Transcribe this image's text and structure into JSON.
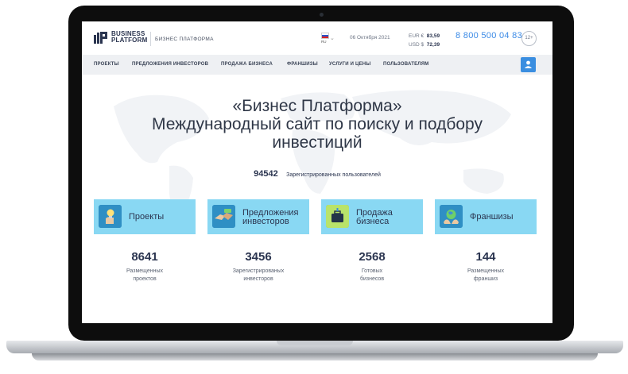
{
  "header": {
    "logo_line1": "BUSINESS",
    "logo_line2": "PLATFORM",
    "slogan": "БИЗНЕС ПЛАТФОРМА",
    "lang_code": "RU",
    "date": "06 Октября 2021",
    "rates": [
      {
        "code": "EUR",
        "symbol": "€",
        "value": "83,59"
      },
      {
        "code": "USD",
        "symbol": "$",
        "value": "72,39"
      }
    ],
    "phone": "8 800 500 04 83",
    "age_badge": "12+"
  },
  "nav": {
    "items": [
      {
        "label": "ПРОЕКТЫ"
      },
      {
        "label": "ПРЕДЛОЖЕНИЯ ИНВЕСТОРОВ"
      },
      {
        "label": "ПРОДАЖА БИЗНЕСА"
      },
      {
        "label": "ФРАНШИЗЫ"
      },
      {
        "label": "УСЛУГИ И ЦЕНЫ"
      },
      {
        "label": "ПОЛЬЗОВАТЕЛЯМ"
      }
    ]
  },
  "hero": {
    "title_line1": "«Бизнес Платформа»",
    "title_line2": "Международный сайт по поиску и подбору",
    "title_line3": "инвестиций",
    "users_count": "94542",
    "users_label": "Зарегистрированных пользователей"
  },
  "cards": [
    {
      "label_line1": "Проекты",
      "label_line2": "",
      "icon": "bulb-icon",
      "count": "8641",
      "stat_line1": "Размещенных",
      "stat_line2": "проектов"
    },
    {
      "label_line1": "Предложения",
      "label_line2": "инвесторов",
      "icon": "handshake-icon",
      "count": "3456",
      "stat_line1": "Зарегистрированых",
      "stat_line2": "инвесторов"
    },
    {
      "label_line1": "Продажа",
      "label_line2": "бизнеса",
      "icon": "briefcase-icon",
      "count": "2568",
      "stat_line1": "Готовых",
      "stat_line2": "бизнесов"
    },
    {
      "label_line1": "Франшизы",
      "label_line2": "",
      "icon": "globe-hands-icon",
      "count": "144",
      "stat_line1": "Размещенных",
      "stat_line2": "франшиз"
    }
  ],
  "colors": {
    "accent": "#3a8ee0",
    "card_bg": "#89d8f3",
    "text_dark": "#2b3550",
    "nav_bg": "#eef0f3"
  }
}
